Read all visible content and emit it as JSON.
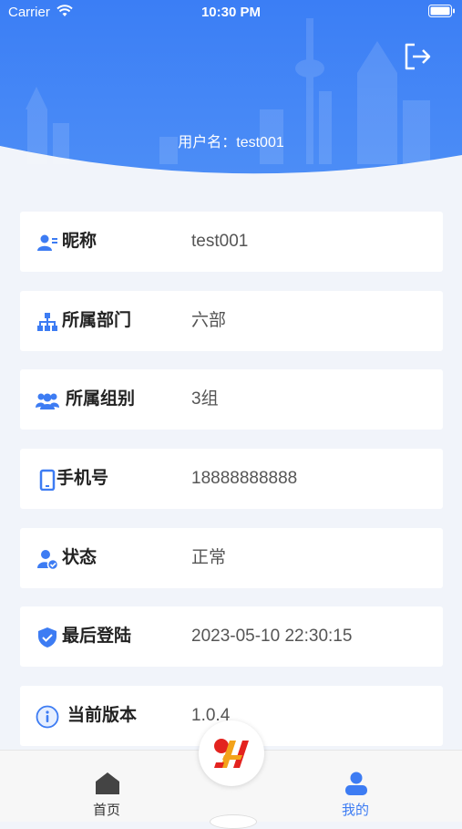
{
  "status_bar": {
    "carrier": "Carrier",
    "time": "10:30 PM"
  },
  "header": {
    "username_text": "用户名：test001",
    "logout_icon": "logout-icon"
  },
  "profile": {
    "rows": [
      {
        "label": "昵称",
        "value": "test001",
        "icon": "user-card-icon"
      },
      {
        "label": "所属部门",
        "value": "六部",
        "icon": "org-chart-icon"
      },
      {
        "label": "所属组别",
        "value": "3组",
        "icon": "group-icon"
      },
      {
        "label": "手机号",
        "value": "18888888888",
        "icon": "phone-icon"
      },
      {
        "label": "状态",
        "value": "正常",
        "icon": "user-check-icon"
      },
      {
        "label": "最后登陆",
        "value": "2023-05-10 22:30:15",
        "icon": "shield-check-icon"
      },
      {
        "label": "当前版本",
        "value": "1.0.4",
        "icon": "info-icon"
      }
    ]
  },
  "tabbar": {
    "home_label": "首页",
    "mine_label": "我的",
    "active_tab": "我的",
    "inactive_color": "#333333",
    "active_color": "#3d7cf3"
  },
  "colors": {
    "accent": "#3d7cf3",
    "background": "#f1f4fa"
  }
}
